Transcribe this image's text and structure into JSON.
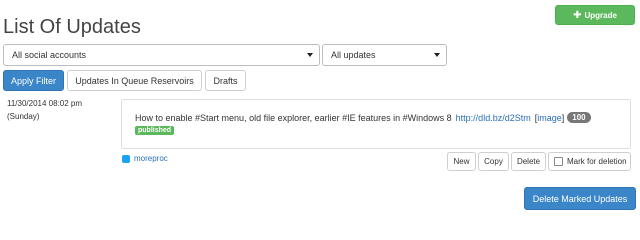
{
  "header": {
    "title": "List Of Updates",
    "upgrade_label": "Upgrade"
  },
  "filters": {
    "accounts_selected": "All social accounts",
    "updates_selected": "All updates"
  },
  "tabs": [
    {
      "label": "Apply Filter"
    },
    {
      "label": "Updates In Queue Reservoirs"
    },
    {
      "label": "Drafts"
    }
  ],
  "update": {
    "date": "11/30/2014 08:02 pm",
    "day": "(Sunday)",
    "text": "How to enable #Start menu, old file explorer, earlier #IE features in #Windows 8",
    "link": "http://dld.bz/d2Stm",
    "image_open": "[",
    "image_label": "image",
    "image_close": "]",
    "count": "100",
    "status": "published",
    "account": "moreproc",
    "actions": {
      "new": "New",
      "copy": "Copy",
      "delete": "Delete",
      "mark_for_deletion": "Mark for deletion"
    }
  },
  "footer": {
    "delete_marked_label": "Delete Marked Updates"
  },
  "colors": {
    "primary": "#3a86c8",
    "success": "#5cb85c",
    "link": "#2a6fb7",
    "twitter": "#1da1f2"
  }
}
